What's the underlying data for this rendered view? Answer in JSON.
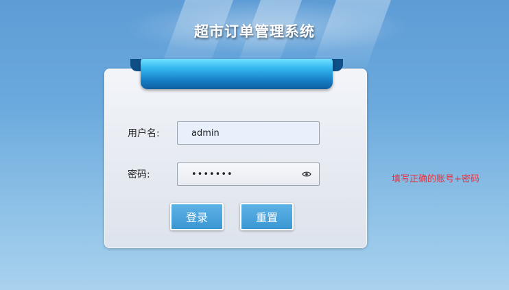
{
  "app": {
    "title": "超市订单管理系统"
  },
  "login_form": {
    "username_label": "用户名:",
    "username_value": "admin",
    "password_label": "密码:",
    "password_masked": "•••••••",
    "login_button": "登录",
    "reset_button": "重置"
  },
  "annotation": {
    "hint": "填写正确的账号+密码"
  },
  "icons": {
    "password_toggle": "eye-icon"
  },
  "colors": {
    "accent": "#3b97d2",
    "hint": "#e8323c",
    "ribbon": "#1579c1"
  }
}
